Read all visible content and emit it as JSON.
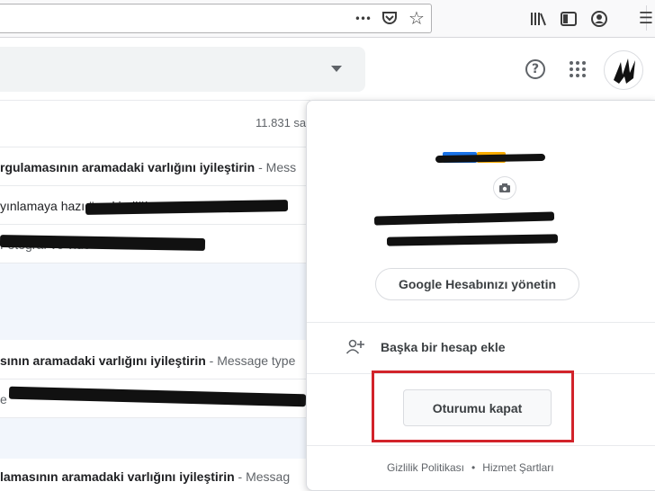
{
  "browser": {
    "icons": [
      "more-dots-icon",
      "pocket-icon",
      "bookmark-star-icon",
      "library-icon",
      "sidebar-icon",
      "account-icon",
      "menu-icon"
    ],
    "more_glyph": "•••",
    "star_glyph": "☆",
    "menu_glyph": "☰"
  },
  "gmail": {
    "help_glyph": "?",
    "count": "11.831 sa",
    "rows": [
      {
        "subject": "rgulamasının aramadaki varlığını iyileştirin",
        "snippet": " - Mess"
      },
      {
        "subject": "",
        "snippet": "yınlamaya hazı                              ünc kindiğin"
      },
      {
        "subject": "",
        "snippet": "                                         Fotoğraf ve vide"
      },
      {
        "subject": "sının aramadaki varlığını iyileştirin",
        "snippet": " - Message type"
      },
      {
        "subject": "",
        "snippet": "e                                                      "
      },
      {
        "subject": "lamasının aramadaki varlığını iyileştirin",
        "snippet": " - Messag"
      }
    ]
  },
  "account_popup": {
    "manage_label": "Google Hesabınızı yönetin",
    "add_account_label": "Başka bir hesap ekle",
    "signout_label": "Oturumu kapat",
    "privacy_label": "Gizlilik Politikası",
    "separator": "•",
    "terms_label": "Hizmet Şartları"
  },
  "colors": {
    "highlight": "#d2232a",
    "brand_blue": "#1a73e8",
    "brand_yellow": "#f9ab00"
  }
}
